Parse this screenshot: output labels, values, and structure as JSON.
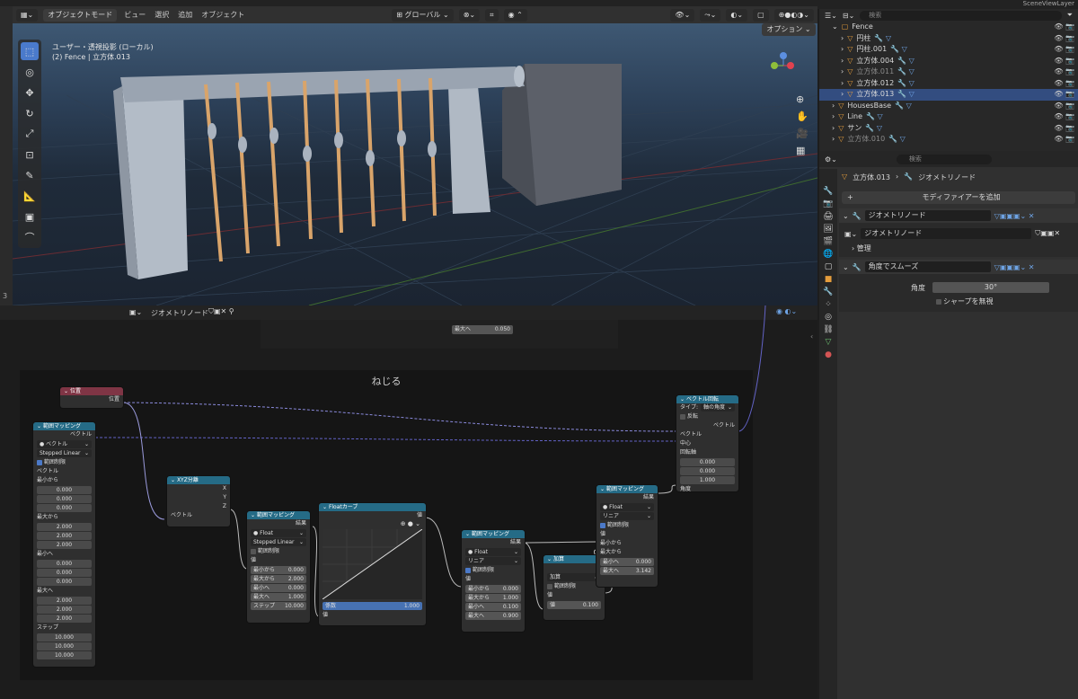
{
  "viewport_header": {
    "mode": "オブジェクトモード",
    "menus": [
      "ビュー",
      "選択",
      "追加",
      "オブジェクト"
    ],
    "transform_orientation": "グローバル",
    "options_label": "オプション"
  },
  "viewport": {
    "view_name": "ユーザー・透視投影 (ローカル)",
    "object_info": "(2) Fence | 立方体.013",
    "frame_label": "3"
  },
  "outliner": {
    "search_placeholder": "検索",
    "top_right": "ViewLayer",
    "scene": "Scene",
    "items": [
      {
        "name": "Fence",
        "indent": 0,
        "selected": false,
        "dim": false
      },
      {
        "name": "円柱",
        "indent": 1,
        "selected": false,
        "dim": false
      },
      {
        "name": "円柱.001",
        "indent": 1,
        "selected": false,
        "dim": false
      },
      {
        "name": "立方体.004",
        "indent": 1,
        "selected": false,
        "dim": false
      },
      {
        "name": "立方体.011",
        "indent": 1,
        "selected": false,
        "dim": true
      },
      {
        "name": "立方体.012",
        "indent": 1,
        "selected": false,
        "dim": false
      },
      {
        "name": "立方体.013",
        "indent": 1,
        "selected": true,
        "dim": false
      },
      {
        "name": "HousesBase",
        "indent": 0,
        "selected": false,
        "dim": false
      },
      {
        "name": "Line",
        "indent": 0,
        "selected": false,
        "dim": false
      },
      {
        "name": "サン",
        "indent": 0,
        "selected": false,
        "dim": false
      },
      {
        "name": "立方体.010",
        "indent": 0,
        "selected": false,
        "dim": true
      }
    ]
  },
  "properties": {
    "search_placeholder": "検索",
    "breadcrumb_object": "立方体.013",
    "breadcrumb_modifier": "ジオメトリノード",
    "add_modifier": "モディファイアーを追加",
    "modifier_name": "ジオメトリノード",
    "node_group": "ジオメトリノード",
    "manage_label": "管理",
    "smooth_modifier": "角度でスムーズ",
    "angle_label": "角度",
    "angle_value": "30°",
    "ignore_sharp": "シャープを無視"
  },
  "node_editor": {
    "header_group": "ジオメトリノード",
    "frame_label": "ねじる",
    "top_node": {
      "label": "最大へ",
      "value": "0.050"
    },
    "position_node": {
      "title": "位置",
      "output": "位置"
    },
    "map_range_vec": {
      "title": "範囲マッピング",
      "output": "ベクトル",
      "type": "ベクトル",
      "interp": "Stepped Linear",
      "clamp": "範囲制限",
      "in_vector": "ベクトル",
      "from_min_label": "最小から",
      "from_min": [
        "0.000",
        "0.000",
        "0.000"
      ],
      "from_max_label": "最大から",
      "from_max": [
        "2.000",
        "2.000",
        "2.000"
      ],
      "to_min_label": "最小へ",
      "to_min": [
        "0.000",
        "0.000",
        "0.000"
      ],
      "to_max_label": "最大へ",
      "to_max": [
        "2.000",
        "2.000",
        "2.000"
      ],
      "steps_label": "ステップ",
      "steps": [
        "10.000",
        "10.000",
        "10.000"
      ]
    },
    "separate_xyz": {
      "title": "XYZ分離",
      "x": "X",
      "y": "Y",
      "z": "Z",
      "input": "ベクトル"
    },
    "map_range_2": {
      "title": "範囲マッピング",
      "output": "結果",
      "type": "Float",
      "interp": "Stepped Linear",
      "clamp": "範囲制限",
      "value_label": "値",
      "rows": [
        {
          "label": "最小から",
          "value": "0.000"
        },
        {
          "label": "最大から",
          "value": "2.000"
        },
        {
          "label": "最小へ",
          "value": "0.000"
        },
        {
          "label": "最大へ",
          "value": "1.000"
        },
        {
          "label": "ステップ",
          "value": "10.000"
        }
      ]
    },
    "float_curve": {
      "title": "Floatカーブ",
      "output": "値",
      "factor_label": "係数",
      "factor": "1.000",
      "value_label": "値"
    },
    "map_range_3": {
      "title": "範囲マッピング",
      "output": "結果",
      "type": "Float",
      "interp": "リニア",
      "clamp": "範囲制限",
      "value_label": "値",
      "rows": [
        {
          "label": "最小から",
          "value": "0.000"
        },
        {
          "label": "最大から",
          "value": "1.000"
        },
        {
          "label": "最小へ",
          "value": "0.100"
        },
        {
          "label": "最大へ",
          "value": "0.900"
        }
      ]
    },
    "math_add": {
      "title": "加算",
      "output": "値",
      "op": "加算",
      "clamp": "範囲制限",
      "value_label": "値",
      "value": "0.100"
    },
    "map_range_4": {
      "title": "範囲マッピング",
      "output": "結果",
      "type": "Float",
      "interp": "リニア",
      "clamp": "範囲制限",
      "value_label": "値",
      "from_min": "最小から",
      "from_max": "最大から",
      "rows": [
        {
          "label": "最小へ",
          "value": "0.000"
        },
        {
          "label": "最大へ",
          "value": "3.142"
        }
      ]
    },
    "vector_rotate": {
      "title": "ベクトル回転",
      "type_label": "タイプ:",
      "type": "軸の角度",
      "invert": "反転",
      "output": "ベクトル",
      "vector": "ベクトル",
      "center": "中心",
      "axis": "回転軸",
      "axis_values": [
        "0.000",
        "0.000",
        "1.000"
      ],
      "angle": "角度"
    }
  },
  "colors": {
    "accent": "#4772b3",
    "node_header": "#256b86",
    "input_header": "#7f3545",
    "selected_row": "#334d80"
  }
}
